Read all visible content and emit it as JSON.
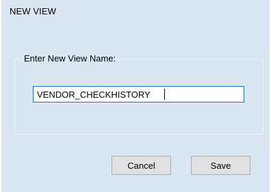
{
  "dialog": {
    "title": "NEW VIEW"
  },
  "form": {
    "group_label": "Enter New View Name:",
    "view_name_value": "VENDOR_CHECKHISTORY",
    "view_name_placeholder": ""
  },
  "actions": {
    "cancel_label": "Cancel",
    "save_label": "Save"
  },
  "colors": {
    "dialog_background": "#dbe6f3",
    "input_focus_border": "#1b6fd1",
    "button_background": "#e1e1e1",
    "button_border": "#acacac"
  }
}
